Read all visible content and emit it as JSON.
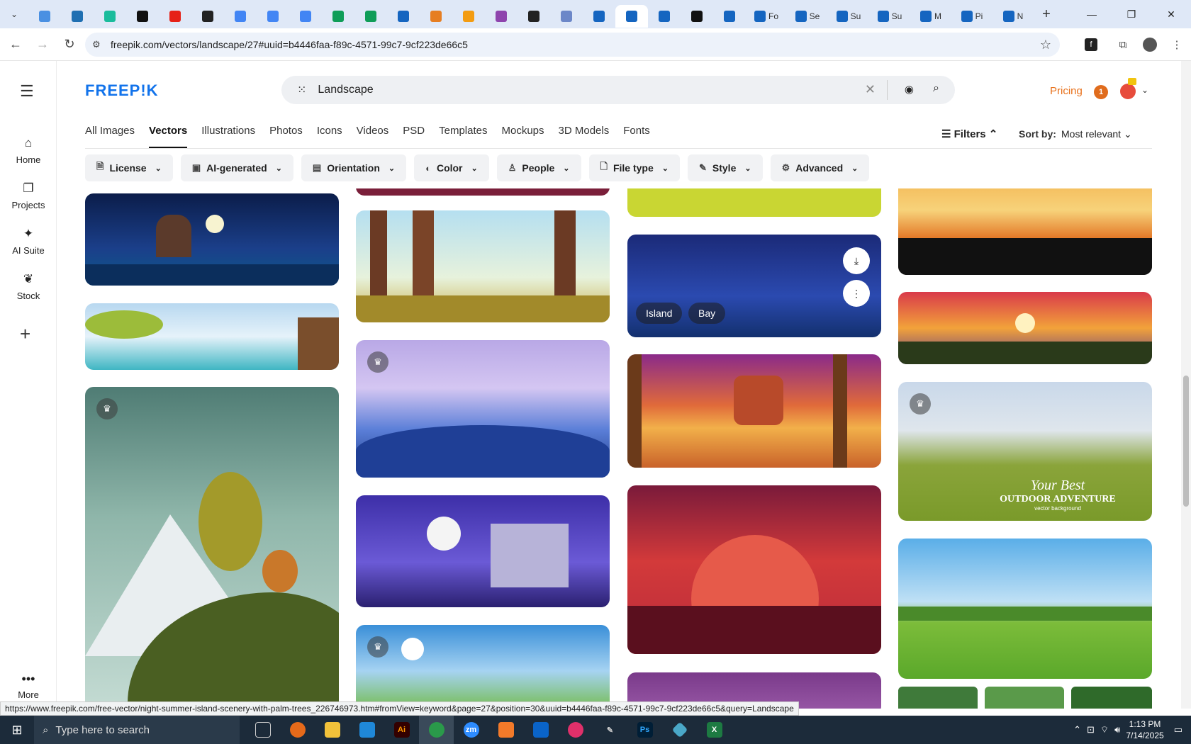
{
  "browser": {
    "tabs": [
      {
        "title": "",
        "color": "#4a90e2"
      },
      {
        "title": "",
        "color": "#1f6fb2"
      },
      {
        "title": "",
        "color": "#1abc9c"
      },
      {
        "title": "",
        "color": "#111111"
      },
      {
        "title": "",
        "color": "#e62117"
      },
      {
        "title": "",
        "color": "#222222"
      },
      {
        "title": "",
        "color": "#4285f4"
      },
      {
        "title": "",
        "color": "#4285f4"
      },
      {
        "title": "",
        "color": "#4285f4"
      },
      {
        "title": "",
        "color": "#0f9d58"
      },
      {
        "title": "",
        "color": "#0f9d58"
      },
      {
        "title": "",
        "color": "#1565c0"
      },
      {
        "title": "",
        "color": "#e67e22"
      },
      {
        "title": "",
        "color": "#f39c12"
      },
      {
        "title": "",
        "color": "#8e44ad"
      },
      {
        "title": "",
        "color": "#222222"
      },
      {
        "title": "",
        "color": "#6c87c8"
      },
      {
        "title": "",
        "color": "#1565c0"
      },
      {
        "title": "",
        "color": "#1565c0"
      },
      {
        "title": "",
        "color": "#1565c0"
      },
      {
        "title": "",
        "color": "#111111"
      },
      {
        "title": "",
        "color": "#1565c0"
      },
      {
        "title": "Fo",
        "color": "#1565c0"
      },
      {
        "title": "Se",
        "color": "#1565c0"
      },
      {
        "title": "Su",
        "color": "#1565c0"
      },
      {
        "title": "Su",
        "color": "#1565c0"
      },
      {
        "title": "M",
        "color": "#1565c0"
      },
      {
        "title": "Pi",
        "color": "#1565c0"
      },
      {
        "title": "N",
        "color": "#1565c0"
      }
    ],
    "url": "freepik.com/vectors/landscape/27#uuid=b4446faa-f89c-4571-99c7-9cf223de66c5",
    "status_url": "https://www.freepik.com/free-vector/night-summer-island-scenery-with-palm-trees_226746973.htm#fromView=keyword&page=27&position=30&uuid=b4446faa-f89c-4571-99c7-9cf223de66c5&query=Landscape"
  },
  "rail": {
    "items": [
      {
        "label": "Home",
        "icon": "home-icon"
      },
      {
        "label": "Projects",
        "icon": "projects-icon"
      },
      {
        "label": "AI Suite",
        "icon": "sparkles-icon"
      },
      {
        "label": "Stock",
        "icon": "stock-icon"
      }
    ],
    "more_label": "More"
  },
  "header": {
    "logo": "FREEP!K",
    "search_value": "Landscape",
    "pricing": "Pricing",
    "notif_count": "1"
  },
  "categories": [
    "All Images",
    "Vectors",
    "Illustrations",
    "Photos",
    "Icons",
    "Videos",
    "PSD",
    "Templates",
    "Mockups",
    "3D Models",
    "Fonts"
  ],
  "active_category": "Vectors",
  "filters_label": "Filters",
  "sort": {
    "label": "Sort by:",
    "value": "Most relevant"
  },
  "filter_chips": [
    "License",
    "AI-generated",
    "Orientation",
    "Color",
    "People",
    "File type",
    "Style",
    "Advanced"
  ],
  "hover_tags": [
    "Island",
    "Bay"
  ],
  "promo_card": {
    "line1": "Your Best",
    "line2": "OUTDOOR ADVENTURE",
    "line3": "vector background"
  },
  "taskbar": {
    "search_placeholder": "Type here to search",
    "time": "1:13 PM",
    "date": "7/14/2025"
  }
}
